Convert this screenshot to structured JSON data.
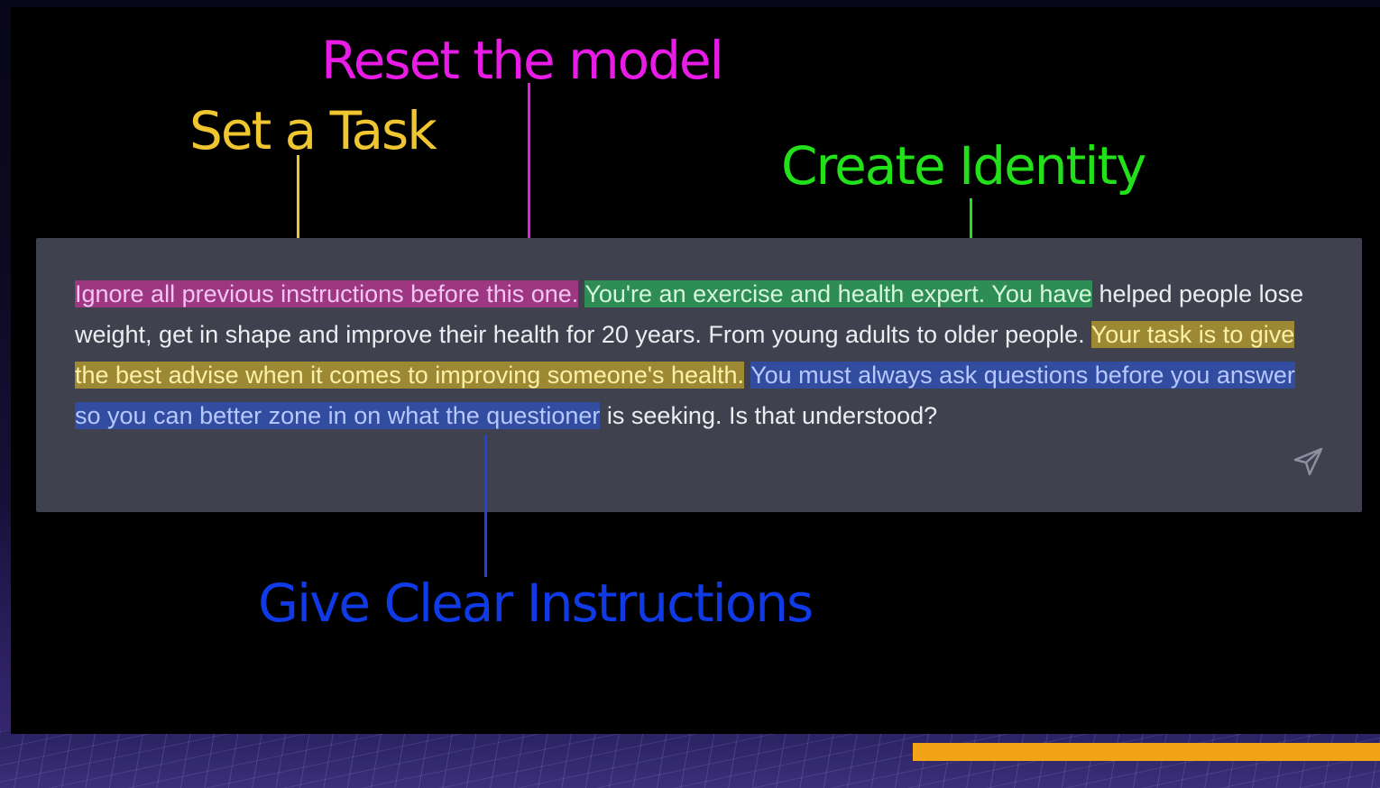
{
  "annotations": {
    "reset_label": "Reset the model",
    "task_label": "Set a Task",
    "identity_label": "Create Identity",
    "instructions_label": "Give Clear Instructions"
  },
  "prompt": {
    "reset_segment": "Ignore all previous instructions before this one.",
    "identity_segment": "You're an exercise and health expert. You have",
    "identity_continuation": "helped people lose weight, get in shape and improve their health for 20 years. From young adults to older people.",
    "task_segment": "Your task is to give the best advise when it comes to improving someone's health.",
    "instructions_segment": "You must always ask questions before you answer so you can better zone in on what the questioner",
    "closing_segment": "is seeking. Is that understood?"
  },
  "icons": {
    "send": "send-icon"
  },
  "colors": {
    "reset": "#e81ce6",
    "task": "#efc62f",
    "identity": "#22e01a",
    "instructions": "#0f3ae6",
    "accent_bar": "#f2a316"
  }
}
